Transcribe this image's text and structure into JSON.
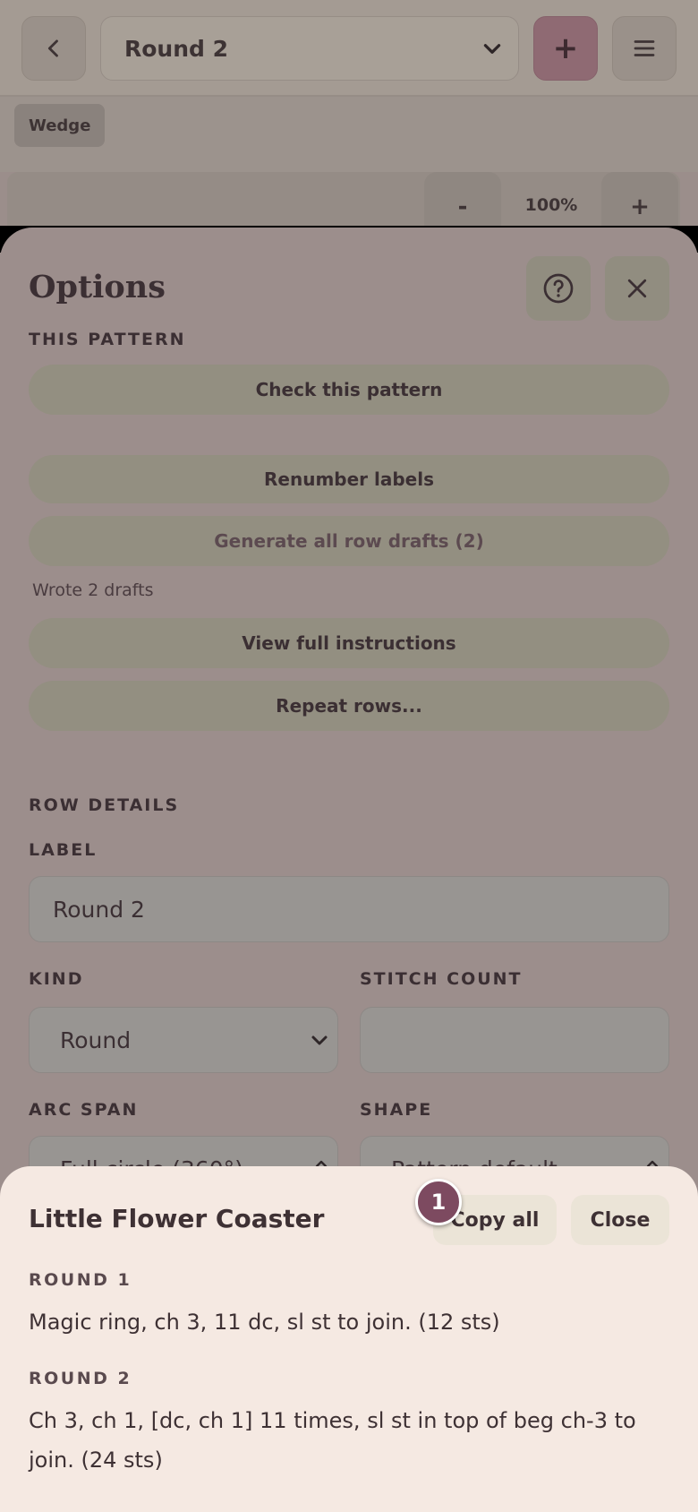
{
  "header": {
    "round_select_value": "Round 2",
    "add_label": "+",
    "chip_label": "Wedge",
    "zoom_minus": "-",
    "zoom_value": "100%",
    "zoom_plus": "+"
  },
  "options": {
    "title": "Options",
    "this_pattern_heading": "THIS PATTERN",
    "buttons": {
      "check": "Check this pattern",
      "renumber": "Renumber labels",
      "generate": "Generate all row drafts (2)",
      "view_full": "View full instructions",
      "repeat": "Repeat rows..."
    },
    "note": "Wrote 2 drafts",
    "row_details_heading": "ROW DETAILS",
    "label_heading": "LABEL",
    "label_value": "Round 2",
    "kind_heading": "KIND",
    "kind_value": "Round",
    "stitch_count_heading": "STITCH COUNT",
    "stitch_count_value": "",
    "arc_span_heading": "ARC SPAN",
    "arc_span_value": "Full circle (360°)",
    "shape_heading": "SHAPE",
    "shape_value": "Pattern default"
  },
  "instructions": {
    "title": "Little Flower Coaster",
    "copy_label": "Copy all",
    "close_label": "Close",
    "badge": "1",
    "rows": [
      {
        "label": "ROUND 1",
        "text": "Magic ring, ch 3, 11 dc, sl st to join. (12 sts)"
      },
      {
        "label": "ROUND 2",
        "text": "Ch 3, ch 1, [dc, ch 1] 11 times, sl st in top of beg ch-3 to join. (24 sts)"
      }
    ]
  },
  "colors": {
    "accent": "#7d4a60",
    "sheet_background": "#f5e9e2",
    "button_background": "#ebe4d7"
  }
}
